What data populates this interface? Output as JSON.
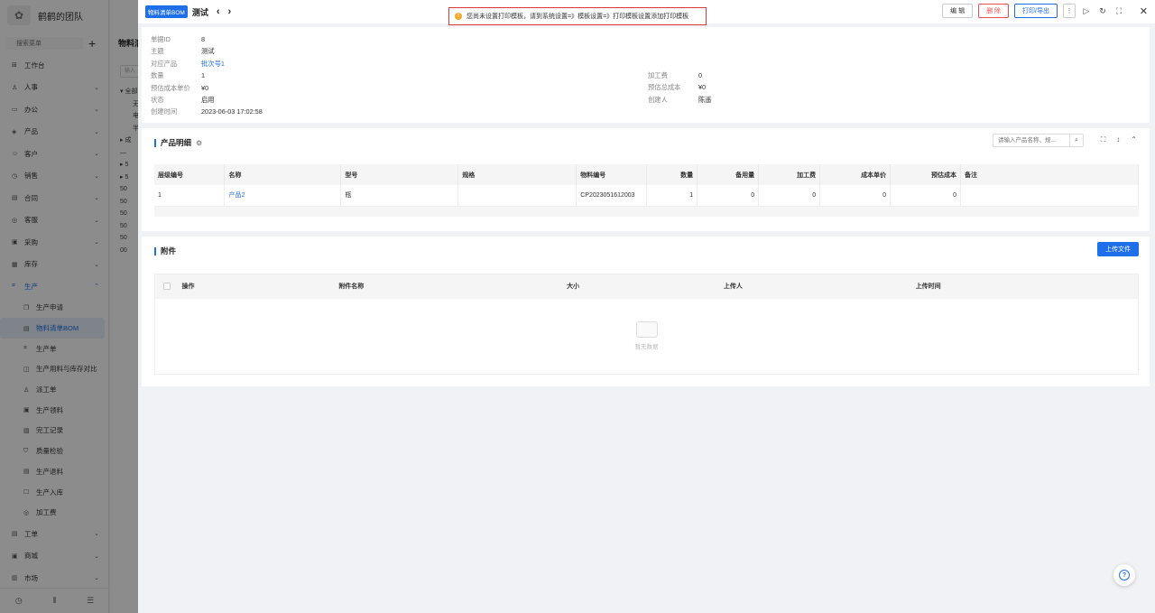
{
  "app": {
    "team_name": "鹤鹤的团队",
    "search_placeholder": "搜索菜单"
  },
  "sidebar": {
    "items": [
      {
        "label": "工作台",
        "icon": "⊞",
        "arrow": ""
      },
      {
        "label": "人事",
        "icon": "♙",
        "arrow": "⌄"
      },
      {
        "label": "办公",
        "icon": "▭",
        "arrow": "⌄"
      },
      {
        "label": "产品",
        "icon": "◈",
        "arrow": "⌄"
      },
      {
        "label": "客户",
        "icon": "☺",
        "arrow": "⌄"
      },
      {
        "label": "销售",
        "icon": "◷",
        "arrow": "⌄"
      },
      {
        "label": "合同",
        "icon": "▤",
        "arrow": "⌄"
      },
      {
        "label": "客服",
        "icon": "◎",
        "arrow": "⌄"
      },
      {
        "label": "采购",
        "icon": "▣",
        "arrow": "⌄"
      },
      {
        "label": "库存",
        "icon": "▦",
        "arrow": "⌄"
      }
    ],
    "production": {
      "label": "生产",
      "icon": "⌗",
      "arrow": "⌃"
    },
    "sub_items": [
      "生产申请",
      "物料清单BOM",
      "生产单",
      "生产用料与库存对比",
      "派工单",
      "生产领料",
      "完工记录",
      "质量检验",
      "生产退料",
      "生产入库",
      "加工费"
    ],
    "after_items": [
      {
        "label": "工单",
        "icon": "▤",
        "arrow": "⌄"
      },
      {
        "label": "商城",
        "icon": "▣",
        "arrow": "⌄"
      },
      {
        "label": "市场",
        "icon": "▥",
        "arrow": "⌄"
      }
    ]
  },
  "background": {
    "title": "物料清",
    "search": "输入",
    "tree": [
      "▾ 全部",
      "无",
      "电",
      "半",
      "▸ 成",
      "—",
      "▸ 5",
      "▸ 5",
      "50",
      "50",
      "50",
      "50",
      "50",
      "00"
    ]
  },
  "drawer": {
    "tag": "物料清单BOM",
    "title": "测试",
    "toast": "您尚未设置打印模板，请到系统设置=》模板设置=》打印模板设置添加打印模板",
    "buttons": {
      "edit": "编 辑",
      "delete": "删 除",
      "print": "打印/导出",
      "more": "⋮"
    },
    "info": {
      "left": [
        {
          "label": "单据ID",
          "value": "8"
        },
        {
          "label": "主题",
          "value": "测试"
        },
        {
          "label": "对应产品",
          "value": "批次号1"
        },
        {
          "label": "数量",
          "value": "1"
        },
        {
          "label": "预估成本单价",
          "value": "¥0"
        },
        {
          "label": "状态",
          "value": "启用"
        },
        {
          "label": "创建时间",
          "value": "2023-06-03 17:02:58"
        }
      ],
      "right": [
        {
          "label": "加工费",
          "value": "0"
        },
        {
          "label": "预估总成本",
          "value": "¥0"
        },
        {
          "label": "创建人",
          "value": "陈遥"
        }
      ]
    },
    "products": {
      "title": "产品明细",
      "search_placeholder": "请输入产品名称、规...",
      "columns": [
        "层级编号",
        "名称",
        "型号",
        "规格",
        "物料编号",
        "数量",
        "备用量",
        "加工费",
        "成本单价",
        "预估成本",
        "备注"
      ],
      "rows": [
        {
          "level": "1",
          "name": "产品2",
          "model": "瓶",
          "spec": "",
          "code": "CP2023051612003",
          "qty": "1",
          "spare": "0",
          "fee": "0",
          "cost": "0",
          "est": "0",
          "remark": ""
        }
      ]
    },
    "attachments": {
      "title": "附件",
      "upload": "上传文件",
      "columns": [
        "操作",
        "附件名称",
        "大小",
        "上传人",
        "上传时间"
      ],
      "empty": "暂无数据"
    }
  }
}
